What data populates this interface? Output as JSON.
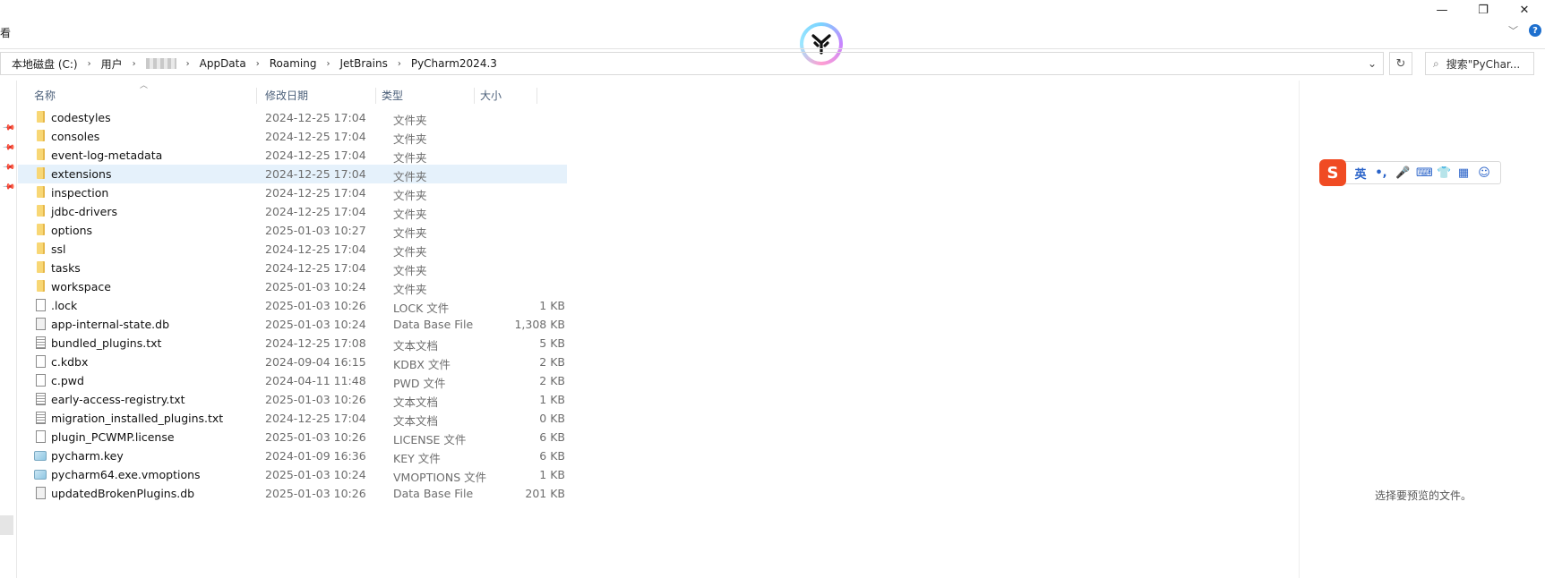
{
  "window": {
    "minimize": "—",
    "restore": "❐",
    "close": "✕",
    "ribbon_tab": "看",
    "expand_chevron": "﹀",
    "help": "?"
  },
  "address": {
    "crumbs": [
      "本地磁盘 (C:)",
      "用户",
      "",
      "AppData",
      "Roaming",
      "JetBrains",
      "PyCharm2024.3"
    ],
    "separator": "›",
    "dropdown": "⌄",
    "refresh": "↻",
    "search_placeholder": "搜索\"PyChar..."
  },
  "columns": {
    "name": "名称",
    "modified": "修改日期",
    "type": "类型",
    "size": "大小"
  },
  "files": [
    {
      "name": "codestyles",
      "date": "2024-12-25 17:04",
      "type": "文件夹",
      "size": "",
      "icon": "folder"
    },
    {
      "name": "consoles",
      "date": "2024-12-25 17:04",
      "type": "文件夹",
      "size": "",
      "icon": "folder"
    },
    {
      "name": "event-log-metadata",
      "date": "2024-12-25 17:04",
      "type": "文件夹",
      "size": "",
      "icon": "folder"
    },
    {
      "name": "extensions",
      "date": "2024-12-25 17:04",
      "type": "文件夹",
      "size": "",
      "icon": "folder"
    },
    {
      "name": "inspection",
      "date": "2024-12-25 17:04",
      "type": "文件夹",
      "size": "",
      "icon": "folder"
    },
    {
      "name": "jdbc-drivers",
      "date": "2024-12-25 17:04",
      "type": "文件夹",
      "size": "",
      "icon": "folder"
    },
    {
      "name": "options",
      "date": "2025-01-03 10:27",
      "type": "文件夹",
      "size": "",
      "icon": "folder"
    },
    {
      "name": "ssl",
      "date": "2024-12-25 17:04",
      "type": "文件夹",
      "size": "",
      "icon": "folder"
    },
    {
      "name": "tasks",
      "date": "2024-12-25 17:04",
      "type": "文件夹",
      "size": "",
      "icon": "folder"
    },
    {
      "name": "workspace",
      "date": "2025-01-03 10:24",
      "type": "文件夹",
      "size": "",
      "icon": "folder"
    },
    {
      "name": ".lock",
      "date": "2025-01-03 10:26",
      "type": "LOCK 文件",
      "size": "1 KB",
      "icon": "file"
    },
    {
      "name": "app-internal-state.db",
      "date": "2025-01-03 10:24",
      "type": "Data Base File",
      "size": "1,308 KB",
      "icon": "db"
    },
    {
      "name": "bundled_plugins.txt",
      "date": "2024-12-25 17:08",
      "type": "文本文档",
      "size": "5 KB",
      "icon": "txt"
    },
    {
      "name": "c.kdbx",
      "date": "2024-09-04 16:15",
      "type": "KDBX 文件",
      "size": "2 KB",
      "icon": "file"
    },
    {
      "name": "c.pwd",
      "date": "2024-04-11 11:48",
      "type": "PWD 文件",
      "size": "2 KB",
      "icon": "file"
    },
    {
      "name": "early-access-registry.txt",
      "date": "2025-01-03 10:26",
      "type": "文本文档",
      "size": "1 KB",
      "icon": "txt"
    },
    {
      "name": "migration_installed_plugins.txt",
      "date": "2024-12-25 17:04",
      "type": "文本文档",
      "size": "0 KB",
      "icon": "txt"
    },
    {
      "name": "plugin_PCWMP.license",
      "date": "2025-01-03 10:26",
      "type": "LICENSE 文件",
      "size": "6 KB",
      "icon": "file"
    },
    {
      "name": "pycharm.key",
      "date": "2024-01-09 16:36",
      "type": "KEY 文件",
      "size": "6 KB",
      "icon": "key"
    },
    {
      "name": "pycharm64.exe.vmoptions",
      "date": "2025-01-03 10:24",
      "type": "VMOPTIONS 文件",
      "size": "1 KB",
      "icon": "key"
    },
    {
      "name": "updatedBrokenPlugins.db",
      "date": "2025-01-03 10:26",
      "type": "Data Base File",
      "size": "201 KB",
      "icon": "db"
    }
  ],
  "selected_row": 3,
  "preview": {
    "empty_text": "选择要预览的文件。"
  },
  "ime": {
    "logo": "S",
    "lang": "英",
    "punct": "•,",
    "mic": "🎤",
    "keyboard": "⌨",
    "skin": "👕",
    "apps": "▦",
    "face": "☺"
  },
  "colors": {
    "selection": "#e5f1fb",
    "folder": "#f8d775",
    "header_text": "#4c607a",
    "ime_brand": "#f04b23"
  }
}
